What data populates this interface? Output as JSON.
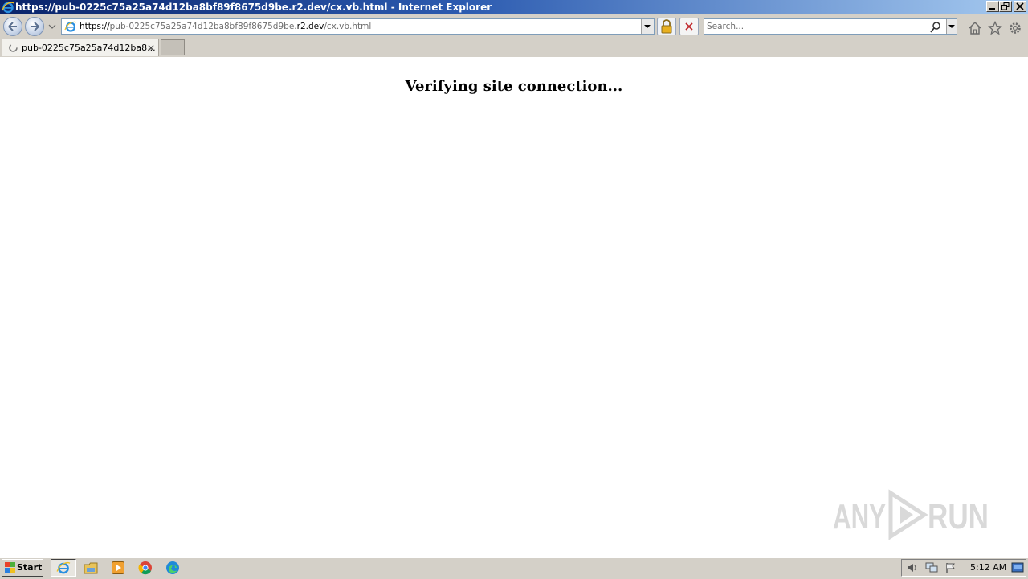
{
  "window": {
    "title": "https://pub-0225c75a25a74d12ba8bf89f8675d9be.r2.dev/cx.vb.html - Internet Explorer"
  },
  "address_bar": {
    "scheme": "https://",
    "host_prefix": "pub-0225c75a25a74d12ba8bf89f8675d9be.",
    "host_domain": "r2.dev",
    "path": "/cx.vb.html"
  },
  "search": {
    "placeholder": "Search..."
  },
  "tabs": [
    {
      "label": "pub-0225c75a25a74d12ba8...",
      "loading": true
    }
  ],
  "page": {
    "heading": "Verifying site connection..."
  },
  "watermark": {
    "text": "ANY RUN"
  },
  "taskbar": {
    "start_label": "Start",
    "pinned": [
      "internet-explorer-icon",
      "file-explorer-icon",
      "media-player-icon",
      "chrome-icon",
      "edge-icon"
    ],
    "tray_icons": [
      "volume-icon",
      "network-icon",
      "action-center-flag-icon"
    ],
    "clock": "5:12 AM"
  },
  "colors": {
    "titlebar_start": "#0a246a",
    "titlebar_end": "#a6caf0",
    "chrome_gray": "#d4d0c8",
    "stop_red": "#c0282d"
  }
}
